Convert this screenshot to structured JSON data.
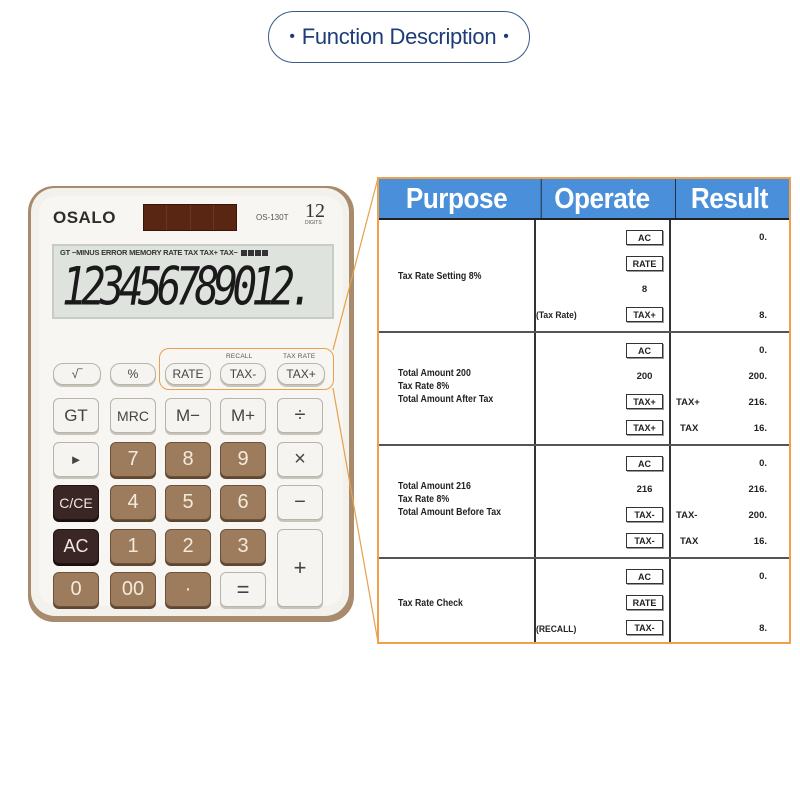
{
  "title": "Function Description",
  "calculator": {
    "brand": "OSALO",
    "model": "OS-130T",
    "digits_count": "12",
    "digits_label": "DIGITS",
    "lcd_indicators": "GT −MINUS ERROR MEMORY RATE TAX TAX+ TAX−",
    "lcd_display": "123456789012.",
    "keys": {
      "sqrt": "√‾",
      "percent": "%",
      "rate": "RATE",
      "tax_minus": "TAX-",
      "tax_plus": "TAX+",
      "recall_label": "RECALL",
      "taxrate_label": "TAX RATE",
      "gt": "GT",
      "mrc": "MRC",
      "m_minus": "M−",
      "m_plus": "M+",
      "divide": "÷",
      "backspace": "►",
      "seven": "7",
      "eight": "8",
      "nine": "9",
      "multiply": "×",
      "cce": "C/CE",
      "four": "4",
      "five": "5",
      "six": "6",
      "minus": "−",
      "ac": "AC",
      "one": "1",
      "two": "2",
      "three": "3",
      "plus": "+",
      "zero": "0",
      "double_zero": "00",
      "decimal": "·",
      "equals": "="
    }
  },
  "table": {
    "headers": [
      "Purpose",
      "Operate",
      "Result"
    ],
    "colors": {
      "header_bg": "#4a8fd9",
      "frame": "#f0a04b"
    },
    "rows": [
      {
        "purpose": [
          "Tax Rate Setting 8%"
        ],
        "steps": [
          {
            "note": "",
            "key": "AC",
            "type": "key",
            "result_label": "",
            "result": "0."
          },
          {
            "note": "",
            "key": "RATE",
            "type": "key",
            "result_label": "",
            "result": ""
          },
          {
            "note": "",
            "key": "8",
            "type": "num",
            "result_label": "",
            "result": ""
          },
          {
            "note": "(Tax Rate)",
            "key": "TAX+",
            "type": "key",
            "result_label": "",
            "result": "8."
          }
        ]
      },
      {
        "purpose": [
          "Total Amount 200",
          "Tax Rate 8%",
          "Total Amount After Tax"
        ],
        "steps": [
          {
            "note": "",
            "key": "AC",
            "type": "key",
            "result_label": "",
            "result": "0."
          },
          {
            "note": "",
            "key": "200",
            "type": "num",
            "result_label": "",
            "result": "200."
          },
          {
            "note": "",
            "key": "TAX+",
            "type": "key",
            "result_label": "TAX+",
            "result": "216."
          },
          {
            "note": "",
            "key": "TAX+",
            "type": "key",
            "result_label": "TAX",
            "result": "16."
          }
        ]
      },
      {
        "purpose": [
          "Total Amount 216",
          "Tax Rate 8%",
          "Total Amount Before Tax"
        ],
        "steps": [
          {
            "note": "",
            "key": "AC",
            "type": "key",
            "result_label": "",
            "result": "0."
          },
          {
            "note": "",
            "key": "216",
            "type": "num",
            "result_label": "",
            "result": "216."
          },
          {
            "note": "",
            "key": "TAX-",
            "type": "key",
            "result_label": "TAX-",
            "result": "200."
          },
          {
            "note": "",
            "key": "TAX-",
            "type": "key",
            "result_label": "TAX",
            "result": "16."
          }
        ]
      },
      {
        "purpose": [
          "Tax Rate Check"
        ],
        "steps": [
          {
            "note": "",
            "key": "AC",
            "type": "key",
            "result_label": "",
            "result": "0."
          },
          {
            "note": "",
            "key": "RATE",
            "type": "key",
            "result_label": "",
            "result": ""
          },
          {
            "note": "(RECALL)",
            "key": "TAX-",
            "type": "key",
            "result_label": "",
            "result": "8."
          }
        ]
      }
    ]
  }
}
